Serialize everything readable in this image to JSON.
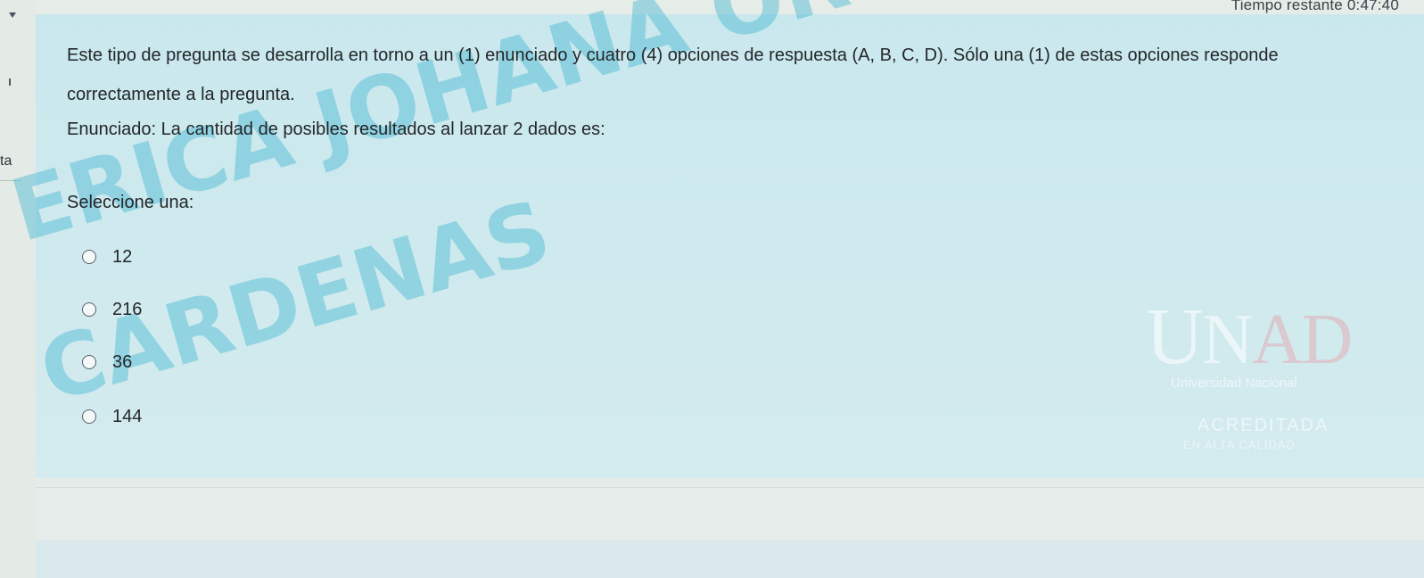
{
  "header": {
    "timer_text": "Tiempo restante 0:47:40"
  },
  "sidebar": {
    "partial_text": "ta"
  },
  "question": {
    "instructions": "Este tipo de pregunta se desarrolla en torno a un (1) enunciado y cuatro (4) opciones de respuesta (A, B, C, D). Sólo una (1) de estas opciones responde correctamente a la pregunta.",
    "statement": "Enunciado: La cantidad de posibles resultados al lanzar 2 dados es:",
    "select_prompt": "Seleccione una:",
    "options": [
      {
        "label": "12"
      },
      {
        "label": "216"
      },
      {
        "label": "36"
      },
      {
        "label": "144"
      }
    ]
  },
  "watermark": {
    "line1": "ERICA JOHANA ORTIZ",
    "line2": "CARDENAS"
  },
  "logo": {
    "mark": "UNAD",
    "subtitle": "Universidad Nacional",
    "accreditation": "ACREDITADA",
    "accreditation_sub": "EN ALTA CALIDAD"
  },
  "colors": {
    "panel": "#cde9ee",
    "watermark": "#4dbad4",
    "text": "#232629"
  }
}
